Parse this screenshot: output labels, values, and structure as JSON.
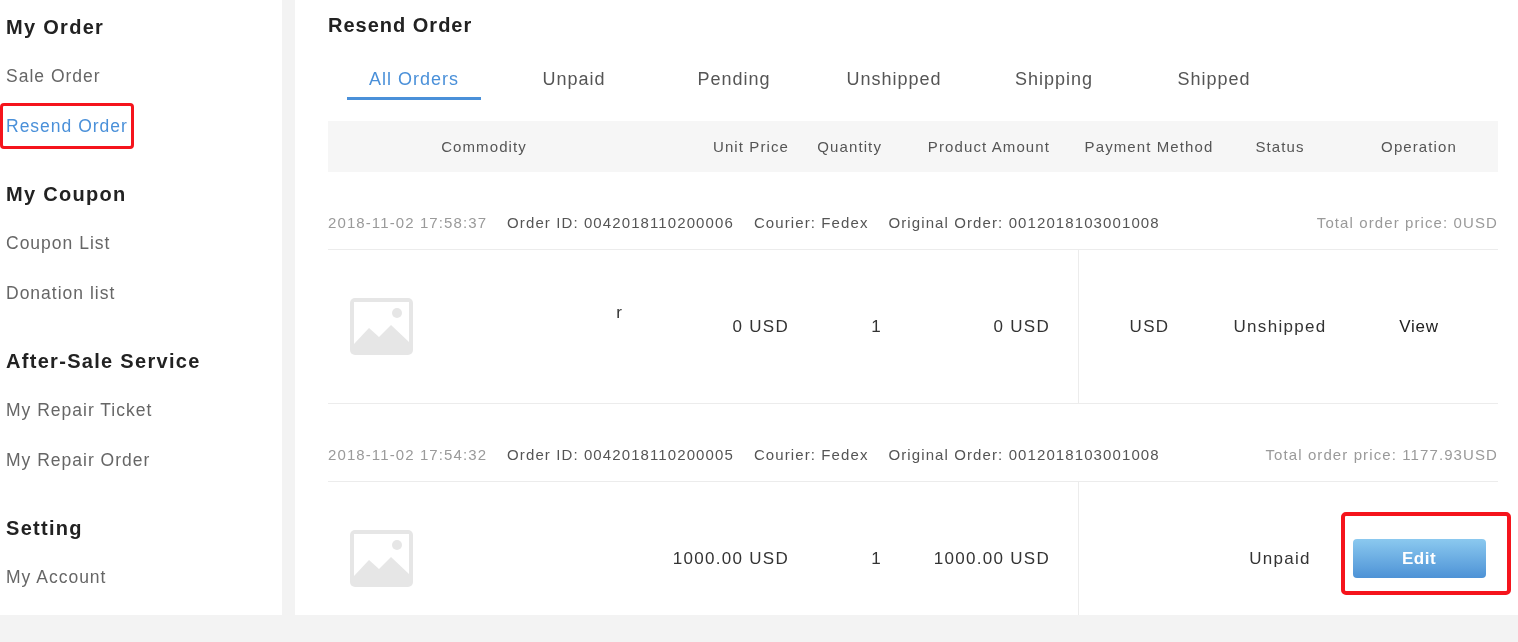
{
  "sidebar": {
    "sections": [
      {
        "title": "My Order",
        "items": [
          {
            "label": "Sale Order",
            "selected": false,
            "highlighted": false
          },
          {
            "label": "Resend Order",
            "selected": true,
            "highlighted": true
          }
        ]
      },
      {
        "title": "My Coupon",
        "items": [
          {
            "label": "Coupon List",
            "selected": false,
            "highlighted": false
          },
          {
            "label": "Donation list",
            "selected": false,
            "highlighted": false
          }
        ]
      },
      {
        "title": "After-Sale Service",
        "items": [
          {
            "label": "My Repair Ticket",
            "selected": false,
            "highlighted": false
          },
          {
            "label": "My Repair Order",
            "selected": false,
            "highlighted": false
          }
        ]
      },
      {
        "title": "Setting",
        "items": [
          {
            "label": "My Account",
            "selected": false,
            "highlighted": false
          }
        ]
      }
    ]
  },
  "page_title": "Resend Order",
  "tabs": [
    {
      "label": "All Orders",
      "selected": true
    },
    {
      "label": "Unpaid",
      "selected": false
    },
    {
      "label": "Pending",
      "selected": false
    },
    {
      "label": "Unshipped",
      "selected": false
    },
    {
      "label": "Shipping",
      "selected": false
    },
    {
      "label": "Shipped",
      "selected": false
    }
  ],
  "table": {
    "columns": [
      "Commodity",
      "Unit Price",
      "Quantity",
      "Product Amount",
      "Payment Method",
      "Status",
      "Operation"
    ],
    "orders": [
      {
        "date": "2018-11-02 17:58:37",
        "order_id": "Order ID: 0042018110200006",
        "courier": "Courier: Fedex",
        "original_order": "Original Order: 0012018103001008",
        "total": "Total order price: 0USD",
        "items": [
          {
            "name": "r",
            "unit_price": "0 USD",
            "quantity": "1",
            "product_amount": "0 USD",
            "payment_method": "USD",
            "status": "Unshipped",
            "operation": {
              "kind": "link",
              "label": "View",
              "highlighted": false
            }
          }
        ]
      },
      {
        "date": "2018-11-02 17:54:32",
        "order_id": "Order ID: 0042018110200005",
        "courier": "Courier: Fedex",
        "original_order": "Original Order: 0012018103001008",
        "total": "Total order price: 1177.93USD",
        "items": [
          {
            "unit_price": "1000.00 USD",
            "quantity": "1",
            "product_amount": "1000.00 USD",
            "status": "Unpaid",
            "operation": {
              "kind": "button",
              "label": "Edit",
              "highlighted": true
            }
          }
        ]
      }
    ]
  }
}
